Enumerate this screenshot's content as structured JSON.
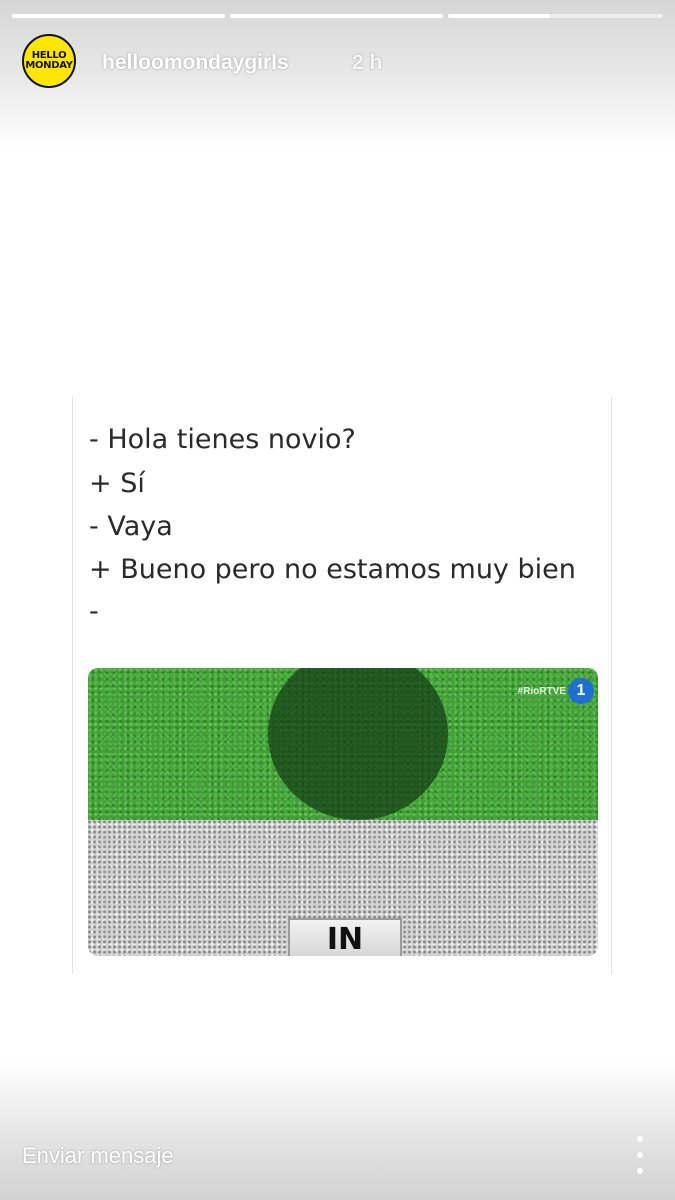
{
  "story": {
    "progress": [
      {
        "fill": 1.0
      },
      {
        "fill": 1.0
      },
      {
        "fill": 0.47
      }
    ],
    "account": {
      "avatar_text": [
        "HELLO",
        "MONDAY"
      ],
      "username": "helloomondaygirls",
      "timestamp": "2 h"
    }
  },
  "post": {
    "lines": [
      "- Hola tienes novio?",
      "+ Sí",
      "- Vaya",
      "+ Bueno pero no estamos muy bien",
      "-"
    ],
    "photo": {
      "watermark": "#RioRTVE",
      "channel_number": "1",
      "sign_text": "IN"
    }
  },
  "footer": {
    "message_placeholder": "Enviar mensaje",
    "more_icon": "more-vertical-icon"
  },
  "colors": {
    "avatar_bg": "#ffe600",
    "grass": "#3fa136",
    "channel_logo": "#1f6fd1"
  }
}
